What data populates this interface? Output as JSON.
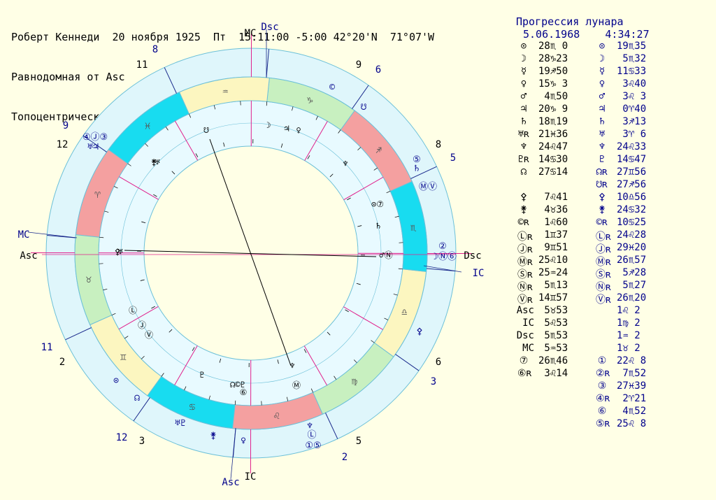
{
  "header": {
    "line1": "Роберт Кеннеди  20 ноября 1925  Пт  15:11:00 -5:00 42°20'N  71°07'W",
    "line2": "Равнодомная от Asc",
    "line3": "Топоцентрическая"
  },
  "progression": {
    "title": "Прогрессия лунара",
    "date": "5.06.1968",
    "time": "4:34:27"
  },
  "colors": {
    "background": "#ffffe6",
    "outer_ring": "#dff6fb",
    "fire": "#f4a0a0",
    "earth": "#c8f0c0",
    "air": "#fcf6c0",
    "water": "#18dcf0",
    "inner_ring": "#e8faff",
    "ring_stroke": "#6cc0d8",
    "aspect": "#000000",
    "natal_text": "#000000",
    "prog_text": "#00008b",
    "house_line_natal": "#e0208c",
    "house_line_prog": "#1a2a8c"
  },
  "zodiac": [
    {
      "sign": "♈",
      "element": "fire"
    },
    {
      "sign": "♉",
      "element": "earth"
    },
    {
      "sign": "♊",
      "element": "air"
    },
    {
      "sign": "♋",
      "element": "water"
    },
    {
      "sign": "♌",
      "element": "fire"
    },
    {
      "sign": "♍",
      "element": "earth"
    },
    {
      "sign": "♎",
      "element": "air"
    },
    {
      "sign": "♏",
      "element": "water"
    },
    {
      "sign": "♐",
      "element": "fire"
    },
    {
      "sign": "♑",
      "element": "earth"
    },
    {
      "sign": "♒",
      "element": "air"
    },
    {
      "sign": "♓",
      "element": "water"
    }
  ],
  "angle_labels": {
    "natal": {
      "asc": "Asc",
      "dsc": "Dsc",
      "mc": "MC",
      "ic": "IC"
    },
    "prog": {
      "asc": "Asc",
      "dsc": "Dsc",
      "mc": "MC",
      "ic": "IC"
    }
  },
  "natal_house_numbers": [
    "1",
    "2",
    "3",
    "4",
    "5",
    "6",
    "7",
    "8",
    "9",
    "10",
    "11",
    "12"
  ],
  "prog_house_numbers": [
    "1",
    "2",
    "3",
    "4",
    "5",
    "6",
    "7",
    "8",
    "9",
    "10",
    "11",
    "12"
  ],
  "wheel_glyphs": {
    "inner": [
      "☽",
      "♃",
      "♀",
      "☋",
      "♅",
      "♆",
      "⊙⑦",
      "♄",
      "♂Ⓝ",
      "♆",
      "Ⓜ",
      "☊©♇",
      "⑥",
      "♇",
      "Ⓛ",
      "Ⓙ",
      "Ⓥ",
      "♅",
      "⚴",
      "⚵"
    ],
    "outer": [
      "©",
      "☋",
      "⑤",
      "♄",
      "ⓂⓋ",
      "②",
      "☽Ⓝ⑥",
      "⚴",
      "♆",
      "Ⓛ",
      "①⑤",
      "♀",
      "⚵",
      "♅♇",
      "☊",
      "⊙",
      "④Ⓙ③",
      "♅♃"
    ]
  },
  "natal_table": [
    {
      "glyph": "⊙",
      "value": "28♏ 0"
    },
    {
      "glyph": "☽",
      "value": "28♑23"
    },
    {
      "glyph": "☿",
      "value": "19♐50"
    },
    {
      "glyph": "♀",
      "value": "15♑ 3"
    },
    {
      "glyph": "♂",
      "value": " 4♏50"
    },
    {
      "glyph": "♃",
      "value": "20♑ 9"
    },
    {
      "glyph": "♄",
      "value": "18♏19"
    },
    {
      "glyph": "♅ʀ",
      "value": "21♓36"
    },
    {
      "glyph": "♆",
      "value": "24♌47"
    },
    {
      "glyph": "♇ʀ",
      "value": "14♋30"
    },
    {
      "glyph": "☊",
      "value": "27♋14"
    },
    {
      "glyph": "",
      "value": ""
    },
    {
      "glyph": "⚴",
      "value": " 7♌41"
    },
    {
      "glyph": "⚵",
      "value": " 4♉36"
    },
    {
      "glyph": "©ʀ",
      "value": " 1♌60"
    },
    {
      "glyph": "Ⓛʀ",
      "value": " 1♊37"
    },
    {
      "glyph": "Ⓙʀ",
      "value": " 9♊51"
    },
    {
      "glyph": "Ⓜʀ",
      "value": "25♌10"
    },
    {
      "glyph": "Ⓢʀ",
      "value": "25♒24"
    },
    {
      "glyph": "Ⓝʀ",
      "value": " 5♏13"
    },
    {
      "glyph": "Ⓥʀ",
      "value": "14♊57"
    },
    {
      "glyph": "Asc",
      "value": " 5♉53"
    },
    {
      "glyph": "IC",
      "value": " 5♌53"
    },
    {
      "glyph": "Dsc",
      "value": " 5♏53"
    },
    {
      "glyph": "MC",
      "value": " 5♒53"
    },
    {
      "glyph": "⑦",
      "value": "26♏46"
    },
    {
      "glyph": "⑥ʀ",
      "value": " 3♌14"
    }
  ],
  "prog_table": [
    {
      "glyph": "⊙",
      "value": "19♏35"
    },
    {
      "glyph": "☽",
      "value": " 5♏32"
    },
    {
      "glyph": "☿",
      "value": "11♋33"
    },
    {
      "glyph": "♀",
      "value": " 3♌40"
    },
    {
      "glyph": "♂",
      "value": " 3♌ 3"
    },
    {
      "glyph": "♃",
      "value": " 0♈40"
    },
    {
      "glyph": "♄",
      "value": " 3♐13"
    },
    {
      "glyph": "♅",
      "value": " 3♈ 6"
    },
    {
      "glyph": "♆",
      "value": "24♌33"
    },
    {
      "glyph": "♇",
      "value": "14♋47"
    },
    {
      "glyph": "☊ʀ",
      "value": "27♊56"
    },
    {
      "glyph": "☋ʀ",
      "value": "27♐56"
    },
    {
      "glyph": "⚴",
      "value": "10♎56"
    },
    {
      "glyph": "⚵",
      "value": "24♋32"
    },
    {
      "glyph": "©ʀ",
      "value": "10♋25"
    },
    {
      "glyph": "Ⓛʀ",
      "value": "24♌28"
    },
    {
      "glyph": "Ⓙʀ",
      "value": "29♓20"
    },
    {
      "glyph": "Ⓜʀ",
      "value": "26♏57"
    },
    {
      "glyph": "Ⓢʀ",
      "value": " 5♐28"
    },
    {
      "glyph": "Ⓝʀ",
      "value": " 5♏27"
    },
    {
      "glyph": "Ⓥʀ",
      "value": "26♏20"
    },
    {
      "glyph": "",
      "value": "1♌ 2"
    },
    {
      "glyph": "",
      "value": "1♍ 2"
    },
    {
      "glyph": "",
      "value": "1♒ 2"
    },
    {
      "glyph": "",
      "value": "1♉ 2"
    },
    {
      "glyph": "①",
      "value": "22♌ 8"
    },
    {
      "glyph": "②ʀ",
      "value": " 7♏52"
    },
    {
      "glyph": "③",
      "value": "27♓39"
    },
    {
      "glyph": "④ʀ",
      "value": " 2♈21"
    },
    {
      "glyph": "⑥",
      "value": " 4♏52"
    },
    {
      "glyph": "⑤ʀ",
      "value": "25♌ 8"
    }
  ]
}
